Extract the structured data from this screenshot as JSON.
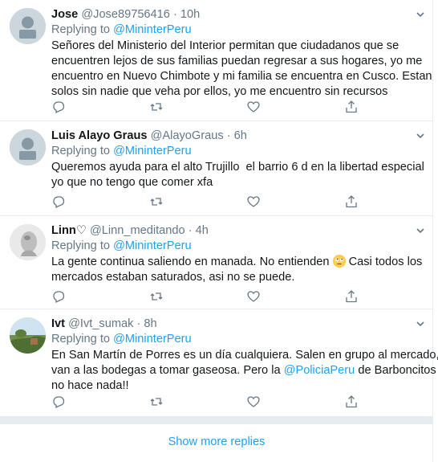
{
  "tweets": [
    {
      "name": "Jose",
      "handle": "@Jose89756416",
      "dot": "·",
      "time": "10h",
      "reply_prefix": "Replying to",
      "reply_to": "@MininterPeru",
      "lines": [
        "Señores del Ministerio del Interior permitan que ciudadanos que se",
        "encuentren lejos de sus familias puedan regresar a sus hogares, yo me",
        "encuentro en Nuevo Chimbote y mi familia se encuentra en Cusco. Estan",
        "solos sin nadie que veha por ellos, yo me encuentro sin recursos"
      ],
      "avatar": "default"
    },
    {
      "name": "Luis Alayo Graus",
      "handle": "@AlayoGraus",
      "dot": "·",
      "time": "6h",
      "reply_prefix": "Replying to",
      "reply_to": "@MininterPeru",
      "lines": [
        "Queremos ayuda para el alto Trujillo  el barrio 6 d en la libertad especial",
        "yo que no tengo que comer xfa"
      ],
      "avatar": "default"
    },
    {
      "name": "Linn♡",
      "handle": "@Linn_meditando",
      "dot": "·",
      "time": "4h",
      "reply_prefix": "Replying to",
      "reply_to": "@MininterPeru",
      "line1_before_emoji": "La gente continua saliendo en manada. No entienden",
      "line1_after_emoji": "Casi todos los",
      "line2": "mercados estaban saturados, asi no se puede.",
      "emoji": "face-with-rolling-eyes",
      "avatar": "photo-grey"
    },
    {
      "name": "Ivt",
      "handle": "@Ivt_sumak",
      "dot": "·",
      "time": "8h",
      "reply_prefix": "Replying to",
      "reply_to": "@MininterPeru",
      "line1": "En San Martín de Porres es un día cualquiera. Salen en grupo al mercado,",
      "line2": "van a las bodegas a tomar gaseosa. Pero la",
      "mention": "@PoliciaPeru",
      "line2_after": "de Barboncitos",
      "line3": "no hace nada!!",
      "avatar": "photo-landscape"
    }
  ],
  "show_more": "Show more replies",
  "colors": {
    "link": "#1da1f2",
    "muted": "#657786",
    "border": "#e6ecf0",
    "text": "#14171a"
  },
  "icons": [
    "reply-icon",
    "retweet-icon",
    "like-icon",
    "share-icon",
    "chevron-down-icon"
  ]
}
